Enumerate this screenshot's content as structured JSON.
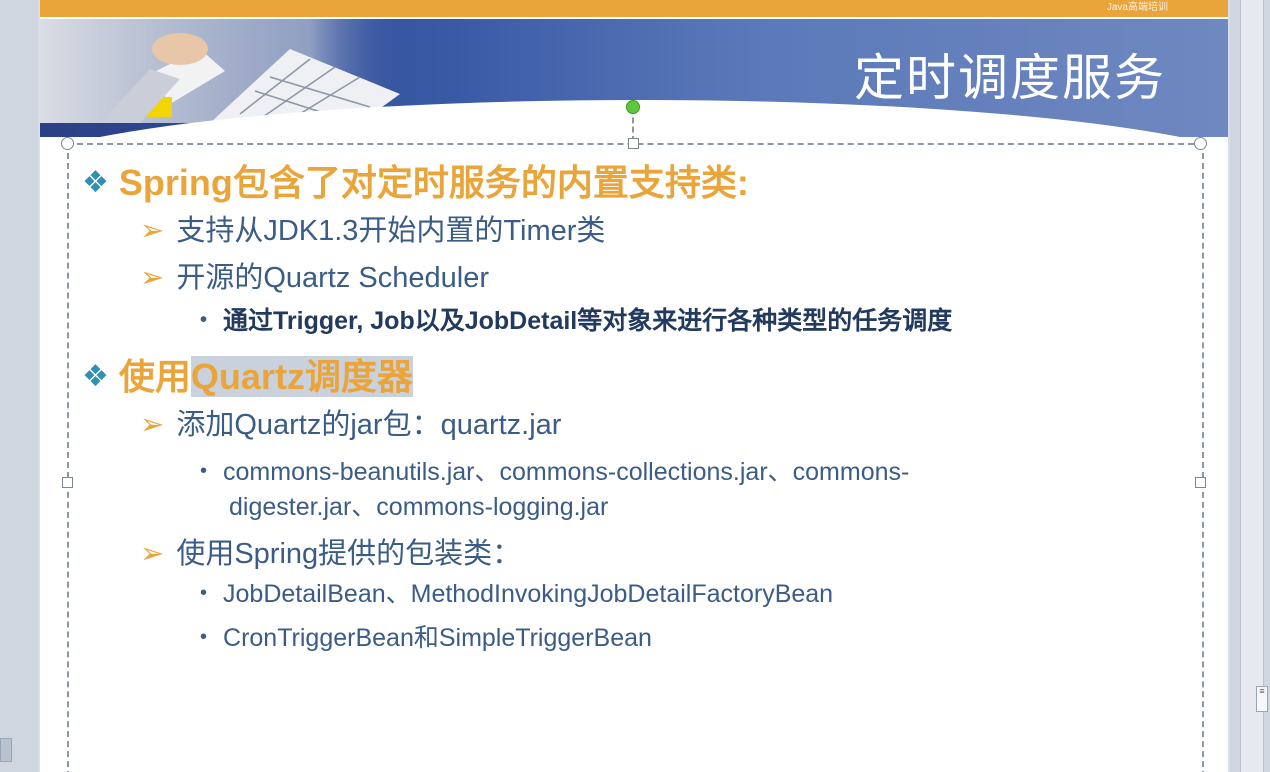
{
  "slide": {
    "title": "定时调度服务",
    "corner_text": "Java高端培训"
  },
  "content": {
    "section1": {
      "heading": "Spring包含了对定时服务的内置支持类:",
      "items": [
        {
          "text": "支持从JDK1.3开始内置的Timer类"
        },
        {
          "text": "开源的Quartz Scheduler",
          "subitems": [
            "通过Trigger, Job以及JobDetail等对象来进行各种类型的任务调度"
          ]
        }
      ]
    },
    "section2": {
      "heading_prefix": "使用",
      "heading_highlight": "Quartz调度器",
      "items": [
        {
          "text": "添加Quartz的jar包：quartz.jar",
          "subitems": [
            "commons-beanutils.jar、commons-collections.jar、commons-",
            "digester.jar、commons-logging.jar"
          ]
        },
        {
          "text": "使用Spring提供的包装类：",
          "subitems": [
            "JobDetailBean、MethodInvokingJobDetailFactoryBean",
            "CronTriggerBean和SimpleTriggerBean"
          ]
        }
      ]
    }
  },
  "icons": {
    "level1_bullet": "diamond-cluster-icon",
    "level2_bullet": "arrow-right-icon",
    "level3_bullet": "dot-icon"
  },
  "colors": {
    "accent_orange": "#e9a43a",
    "text_blue": "#3b5c86",
    "banner_blue": "#3a5aa6"
  }
}
